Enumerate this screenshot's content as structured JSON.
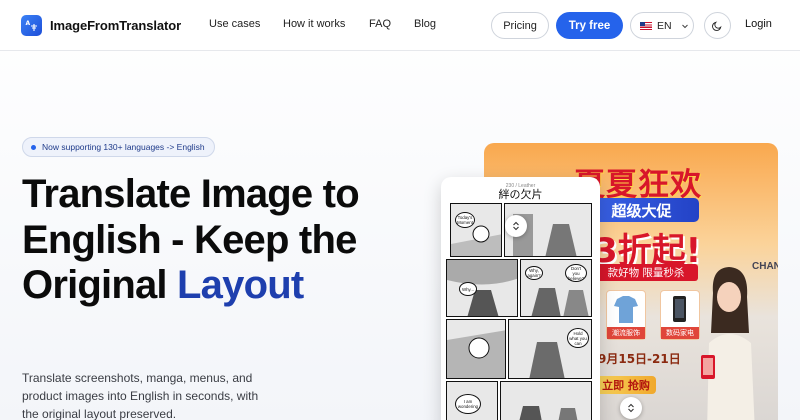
{
  "header": {
    "brand": "ImageFromTranslator",
    "nav": [
      "Use cases",
      "How it works",
      "FAQ",
      "Blog"
    ],
    "pricing_label": "Pricing",
    "try_label": "Try free",
    "language": "EN",
    "login_label": "Login"
  },
  "hero": {
    "badge": "Now supporting 130+ languages -> English",
    "headline_part1": "Translate Image to English - Keep the Original ",
    "headline_accent": "Layout",
    "subtext": "Translate screenshots, manga, menus, and product images into English in seconds, with the original layout preserved."
  },
  "shop_example": {
    "title": "夏夏狂欢",
    "banner": "超级大促",
    "big": "3折起!",
    "sub": "款好物 限量秒杀",
    "goods": [
      "潮流服饰",
      "数码家电"
    ],
    "date": "9月15日-21日",
    "buy": "立即 抢购",
    "sign": "CHAN"
  },
  "manga_example": {
    "page_no": "230 / Leather",
    "title": "絆の欠片",
    "bubbles": [
      "Today's Moment",
      "Why...",
      "Why, again?",
      "Don't you believe?",
      "Hold what you can",
      "I am wondering"
    ]
  },
  "colors": {
    "accent": "#2563eb",
    "headline_accent": "#1e3fae"
  }
}
